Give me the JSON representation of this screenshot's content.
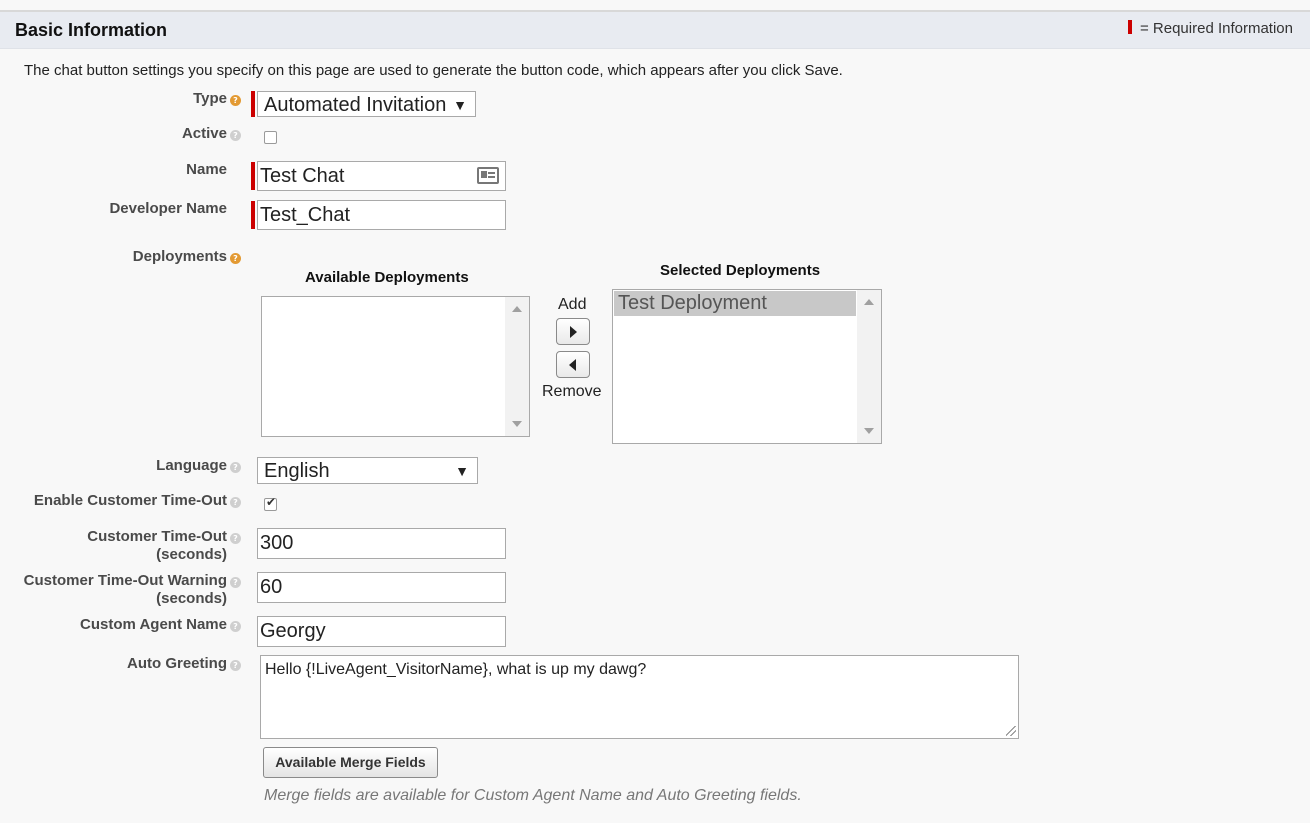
{
  "section": {
    "title": "Basic Information",
    "required_legend": "= Required Information"
  },
  "intro": "The chat button settings you specify on this page are used to generate the button code, which appears after you click Save.",
  "fields": {
    "type": {
      "label": "Type",
      "value": "Automated Invitation"
    },
    "active": {
      "label": "Active",
      "checked": false
    },
    "name": {
      "label": "Name",
      "value": "Test Chat"
    },
    "developer_name": {
      "label": "Developer Name",
      "value": "Test_Chat"
    },
    "deployments": {
      "label": "Deployments",
      "available_title": "Available Deployments",
      "selected_title": "Selected Deployments",
      "available": [],
      "selected": [
        "Test Deployment"
      ],
      "add_label": "Add",
      "remove_label": "Remove"
    },
    "language": {
      "label": "Language",
      "value": "English"
    },
    "enable_timeout": {
      "label": "Enable Customer Time-Out",
      "checked": true
    },
    "timeout": {
      "label_line1": "Customer Time-Out",
      "label_line2": "(seconds)",
      "value": "300"
    },
    "timeout_warning": {
      "label_line1": "Customer Time-Out Warning",
      "label_line2": "(seconds)",
      "value": "60"
    },
    "agent_name": {
      "label": "Custom Agent Name",
      "value": "Georgy"
    },
    "auto_greeting": {
      "label": "Auto Greeting",
      "value": "Hello {!LiveAgent_VisitorName}, what is up my dawg?"
    }
  },
  "merge_button": "Available Merge Fields",
  "merge_hint": "Merge fields are available for Custom Agent Name and Auto Greeting fields.",
  "colors": {
    "required": "#cc0000",
    "header_bg": "#e8ebf1",
    "help_orange": "#e39a33"
  },
  "icons": {
    "help": "help-icon",
    "contact_card": "contact-card-icon"
  }
}
